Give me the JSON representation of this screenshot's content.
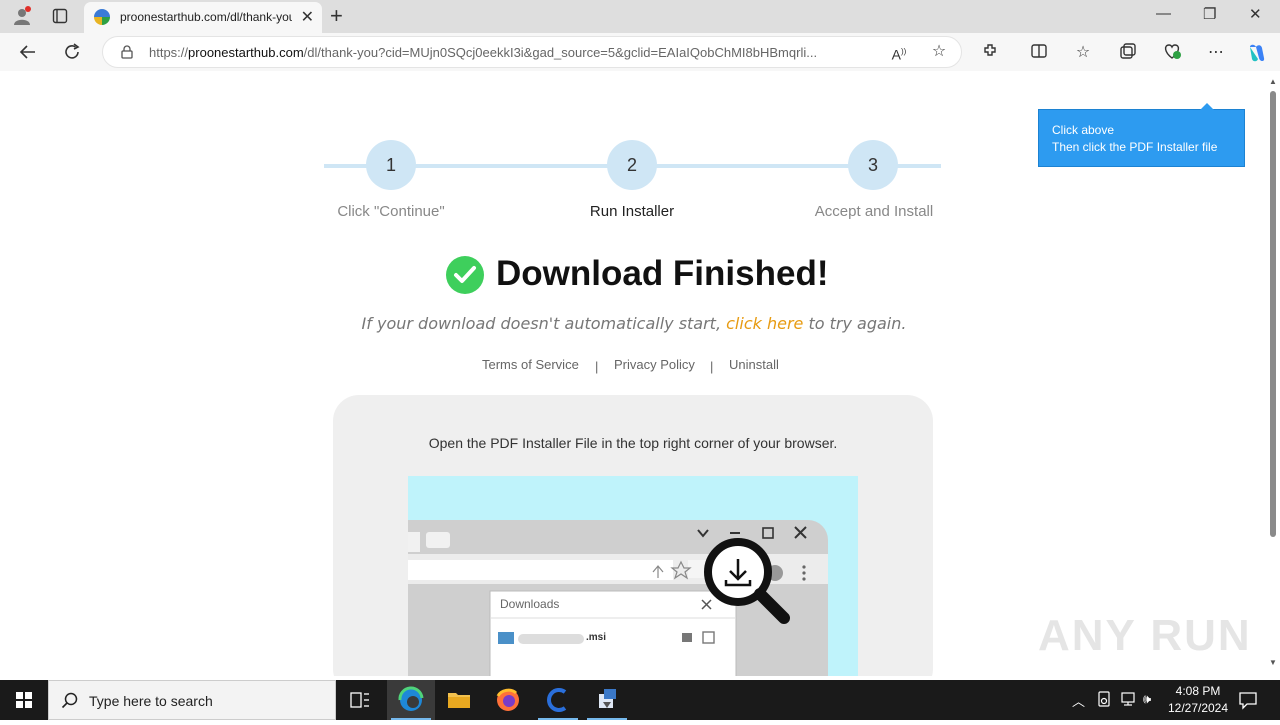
{
  "browser": {
    "tab_title": "proonestarthub.com/dl/thank-you",
    "url_host": "proonestarthub.com",
    "url_prefix": "https://",
    "url_path": "/dl/thank-you?cid=MUjn0SQcj0eekkI3i&gad_source=5&gclid=EAIaIQobChMI8bHBmqrli..."
  },
  "steps": [
    {
      "number": "1",
      "label": "Click \"Continue\""
    },
    {
      "number": "2",
      "label": "Run Installer"
    },
    {
      "number": "3",
      "label": "Accept and Install"
    }
  ],
  "headline": "Download Finished!",
  "retry": {
    "before": "If your download doesn't automatically start, ",
    "link": "click here",
    "after": " to try again."
  },
  "links": {
    "terms": "Terms of Service",
    "privacy": "Privacy Policy",
    "uninstall": "Uninstall",
    "separator": "|"
  },
  "card": {
    "instruction": "Open the PDF Installer File in the top right corner of your browser.",
    "downloads_title": "Downloads",
    "file_ext": ".msi"
  },
  "tooltip": {
    "line1": "Click above",
    "line2": "Then click the PDF Installer file"
  },
  "taskbar": {
    "search_placeholder": "Type here to search",
    "time": "4:08 PM",
    "date": "12/27/2024"
  },
  "watermark": "ANY RUN",
  "colors": {
    "step_circle": "#cfe6f5",
    "accent_link": "#e79b12",
    "check_green": "#3ecf5c",
    "tooltip_bg": "#2d9bf0"
  }
}
